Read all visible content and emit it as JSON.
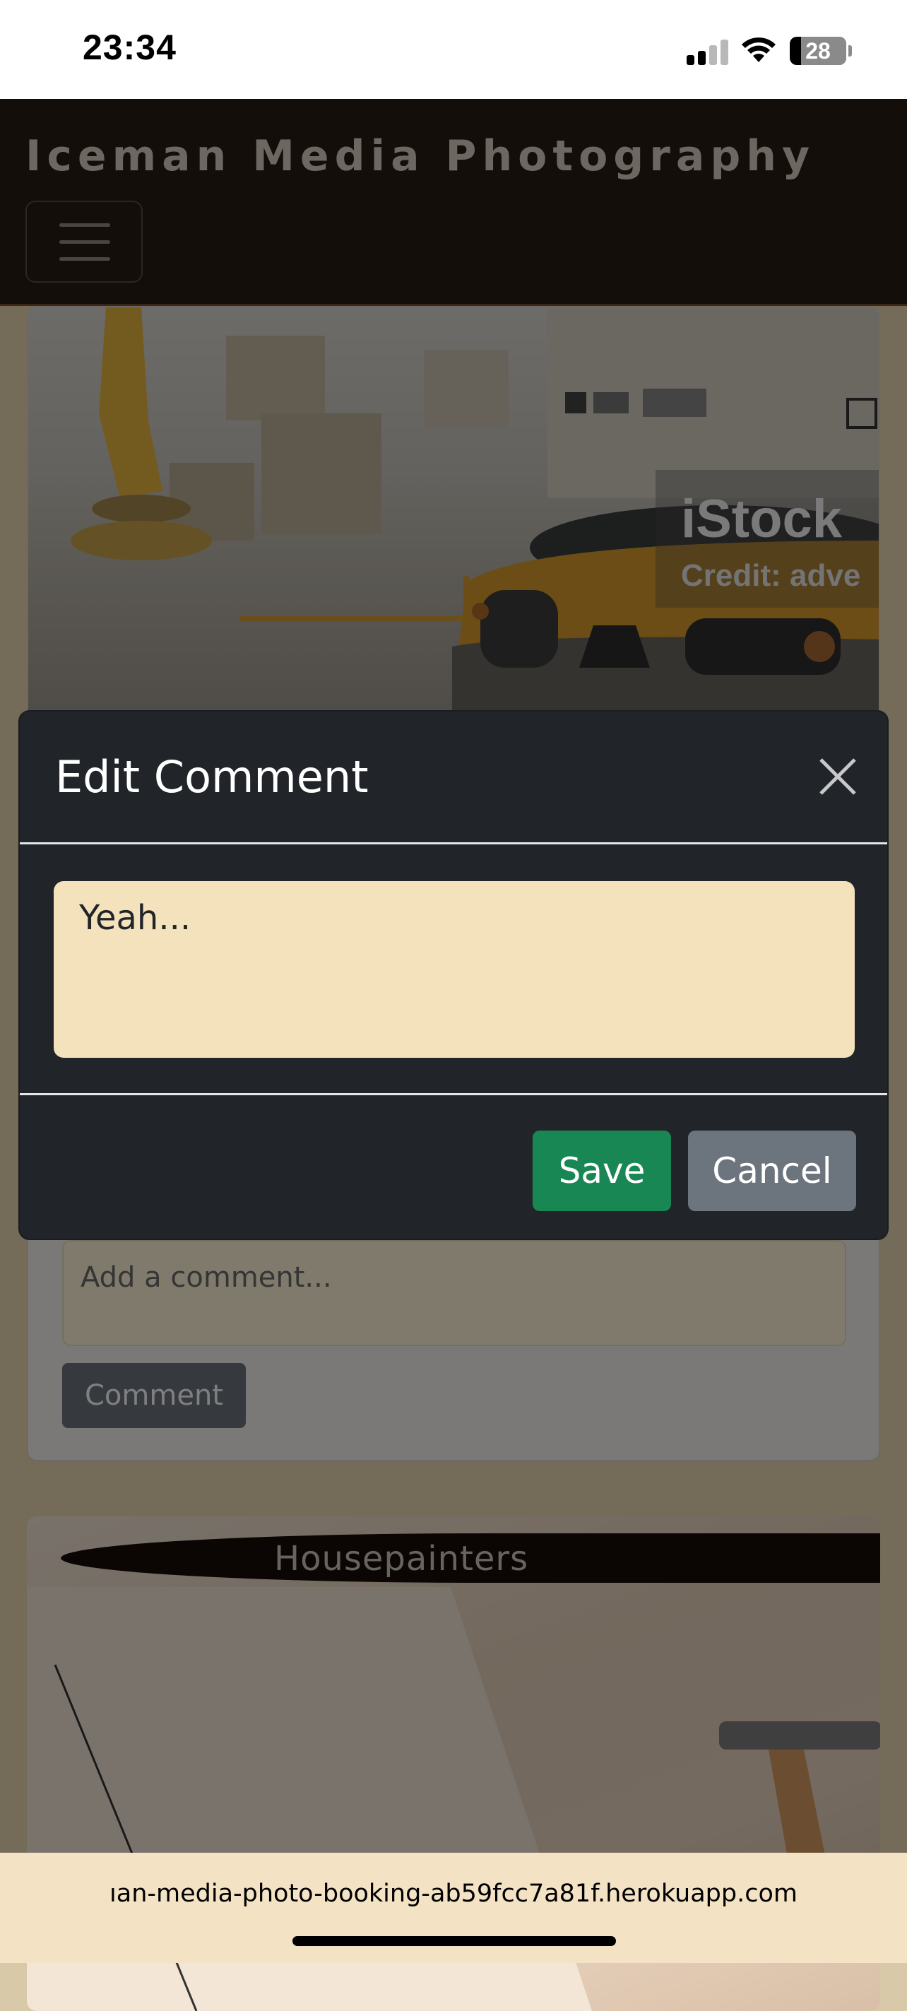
{
  "status_bar": {
    "time": "23:34",
    "battery": "28",
    "icons": [
      "cellular-signal-icon",
      "wifi-icon",
      "battery-icon"
    ]
  },
  "navbar": {
    "brand": "Iceman Media Photography",
    "toggler_icon": "hamburger-menu-icon"
  },
  "image_watermark": {
    "brand": "iStock",
    "credit": "Credit: adve"
  },
  "modal": {
    "title": "Edit Comment",
    "close_icon": "close-icon",
    "comment_value": "Yeah...",
    "save_label": "Save",
    "cancel_label": "Cancel"
  },
  "background_post": {
    "comment_placeholder": "Add a comment...",
    "comment_button": "Comment"
  },
  "next_post": {
    "title": "Housepainters"
  },
  "browser": {
    "url": "ıan-media-photo-booking-ab59fcc7a81f.herokuapp.com"
  },
  "colors": {
    "navbar_bg": "#140e0b",
    "modal_bg": "#212529",
    "textarea_bg": "#f4e2bc",
    "save_btn": "#198754",
    "cancel_btn": "#6c757d",
    "url_bar_bg": "#f3e2c3"
  }
}
